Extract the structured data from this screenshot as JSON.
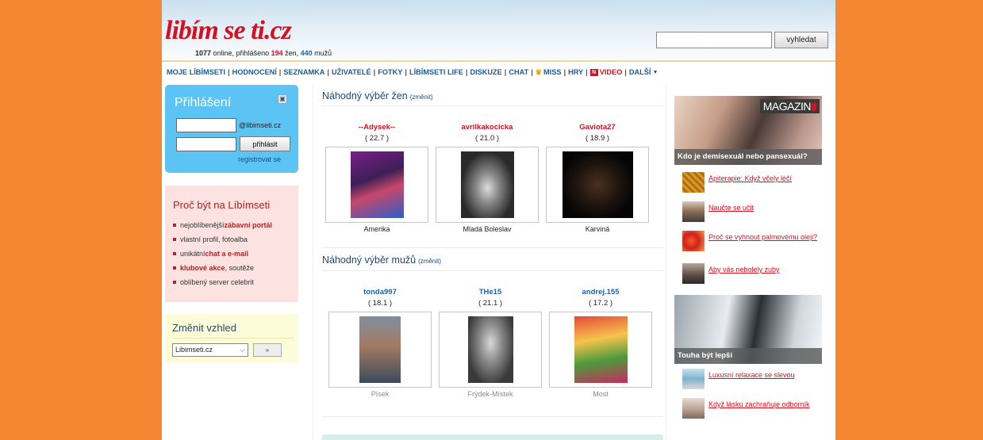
{
  "site": {
    "logo": "libím se ti.cz",
    "online_count": "1077",
    "online_text": " online, přihlášeno ",
    "women_count": "194",
    "women_text": " žen, ",
    "men_count": "440",
    "men_text": " mužů"
  },
  "search": {
    "placeholder": "",
    "button_label": "vyhledat"
  },
  "nav": {
    "items": [
      "MOJE LÍBÍMSETI",
      "HODNOCENÍ",
      "SEZNAMKA",
      "UŽIVATELÉ",
      "FOTKY",
      "LÍBÍMSETI LIFE",
      "DISKUZE",
      "CHAT",
      "MISS",
      "HRY",
      "VIDEO",
      "DALŠÍ"
    ],
    "separator": "|",
    "video_badge": "N"
  },
  "login": {
    "title": "Přihlášení",
    "domain_suffix": "@libimseti.cz",
    "button_label": "přihlásit",
    "register_label": "registrovat se"
  },
  "why": {
    "title": "Proč být na Líbímseti",
    "items": [
      {
        "pre": "nejoblíbenější ",
        "strong": "zábavní portál",
        "post": ""
      },
      {
        "pre": "vlastní profil, fotoalba",
        "strong": "",
        "post": ""
      },
      {
        "pre": "unikátní ",
        "strong": "chat a e-mail",
        "post": ""
      },
      {
        "pre": "",
        "strong": "klubové akce",
        "post": ", soutěže"
      },
      {
        "pre": "oblíbený server celebrit",
        "strong": "",
        "post": ""
      }
    ]
  },
  "skin": {
    "title": "Změnit vzhled",
    "selected": "Libimseti.cz",
    "button_label": "»"
  },
  "women_section": {
    "title": "Náhodný výběr žen",
    "change": "(změnit)",
    "people": [
      {
        "name": "--Adysek--",
        "score": "( 22.7 )",
        "town": "Amerika"
      },
      {
        "name": "avrilkakocicka",
        "score": "( 21.0 )",
        "town": "Mladá Boleslav"
      },
      {
        "name": "Gaviota27",
        "score": "( 18.9 )",
        "town": "Karviná"
      }
    ]
  },
  "men_section": {
    "title": "Náhodný výběr mužů",
    "change": "(změnit)",
    "people": [
      {
        "name": "tonda997",
        "score": "( 18.1 )",
        "town": "Písek"
      },
      {
        "name": "THe15",
        "score": "( 21.1 )",
        "town": "Frýdek-Místek"
      },
      {
        "name": "andrej.155",
        "score": "( 17.2 )",
        "town": "Most"
      }
    ]
  },
  "magazine": {
    "logo": "MAGAZIN",
    "caption": "Kdo je demisexuál nebo pansexuál?",
    "articles": [
      "Apiterapie: Když včely léčí",
      "Naučte se učit",
      "Proč se vyhnout palmovému oleji?",
      "Aby vás nebolely zuby"
    ]
  },
  "banner2": {
    "caption": "Touha být lepší",
    "articles": [
      "Luxusní relaxace se slevou",
      "Když lásku zachraňuje odborník"
    ]
  },
  "colors": {
    "background": "#f58632",
    "brand_red": "#d5101f",
    "brand_blue": "#1c62b0",
    "login_box": "#5cc4f5",
    "why_box": "#fde2e2",
    "skin_box": "#fdfcd9"
  }
}
